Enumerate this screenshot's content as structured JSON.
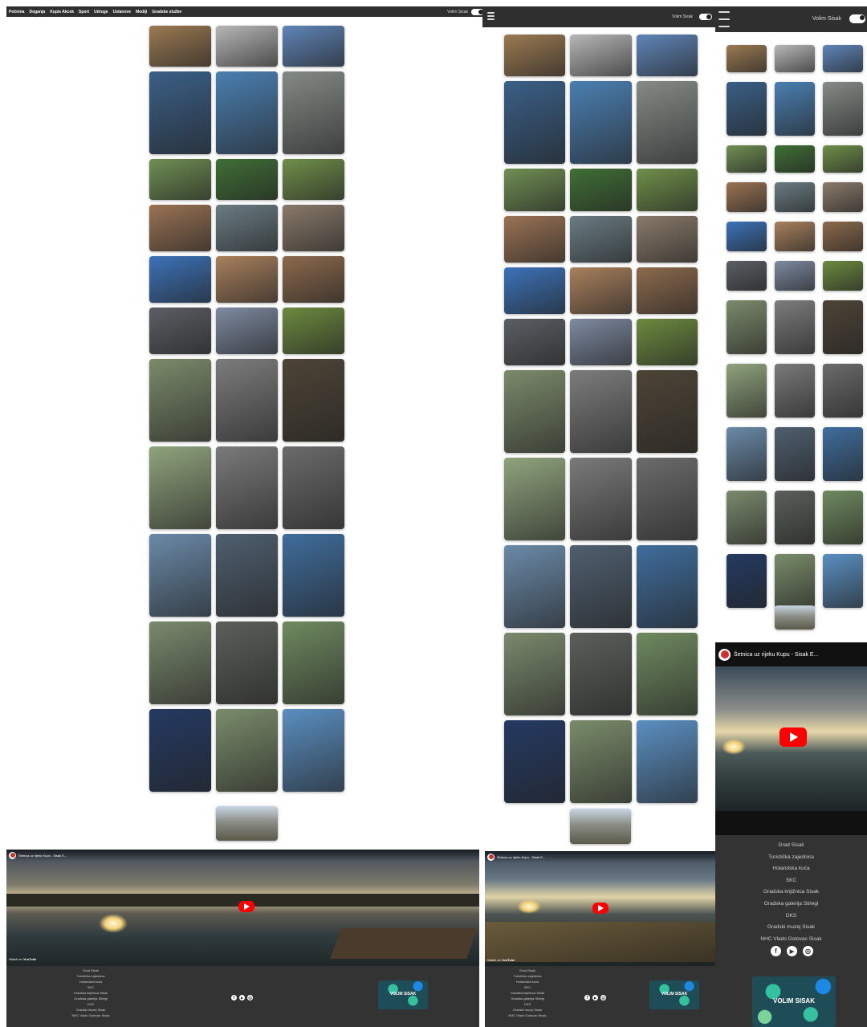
{
  "nav": {
    "items": [
      "Početna",
      "Doganja",
      "Kupis Akcek",
      "Sport",
      "Udruge",
      "Ustanove",
      "Mediji",
      "Gradske službe"
    ],
    "toggle_label": "Volim Sisak"
  },
  "gallery": {
    "colors": [
      [
        "#9b7a52",
        "#b7b7b7",
        "#5f85b8"
      ],
      [
        "#3a5f86",
        "#4a7fb1",
        "#848a86"
      ],
      [
        "#6f8f53",
        "#3f6f35",
        "#6f8f49"
      ],
      [
        "#9a7354",
        "#6a7c83",
        "#8a7a6a"
      ],
      [
        "#3c72b8",
        "#a8805c",
        "#8c6a4c"
      ],
      [
        "#5b5e63",
        "#7d8aa0",
        "#6c8a3f"
      ],
      [
        "#7b8a6a",
        "#7c7c7c",
        "#4d4436"
      ],
      [
        "#8fa37c",
        "#7a7a7a",
        "#6b6b6b"
      ],
      [
        "#6a8aa8",
        "#4f5f6f",
        "#3f6d9c"
      ],
      [
        "#7a8a6d",
        "#5b5f5a",
        "#6f8a5f"
      ],
      [
        "#243a62",
        "#7a8c6a",
        "#5a8fc1"
      ]
    ],
    "last": "#8b8e86"
  },
  "video": {
    "title": "Šetnica uz rijeku Kupu - Sisak E...",
    "watch_label": "Watch on",
    "platform": "YouTube"
  },
  "footer": {
    "links": [
      "Grad Sisak",
      "Turistička zajednica",
      "Holandska kuća",
      "SKC",
      "Gradska knjižnica Sisak",
      "Gradska galerija Striegl",
      "DKS",
      "Gradski muzej Sisak",
      "NHC Vlado Gotovac Sisak"
    ],
    "socials": [
      "f",
      "▶",
      "◎"
    ],
    "badge_text": "VOLIM SISAK"
  },
  "colors": {
    "bar": "#2f2f2f",
    "footer": "#333333",
    "badge_bg": "#1f4d57",
    "badge_accent": "#35c0a0",
    "play": "#ff0000"
  }
}
